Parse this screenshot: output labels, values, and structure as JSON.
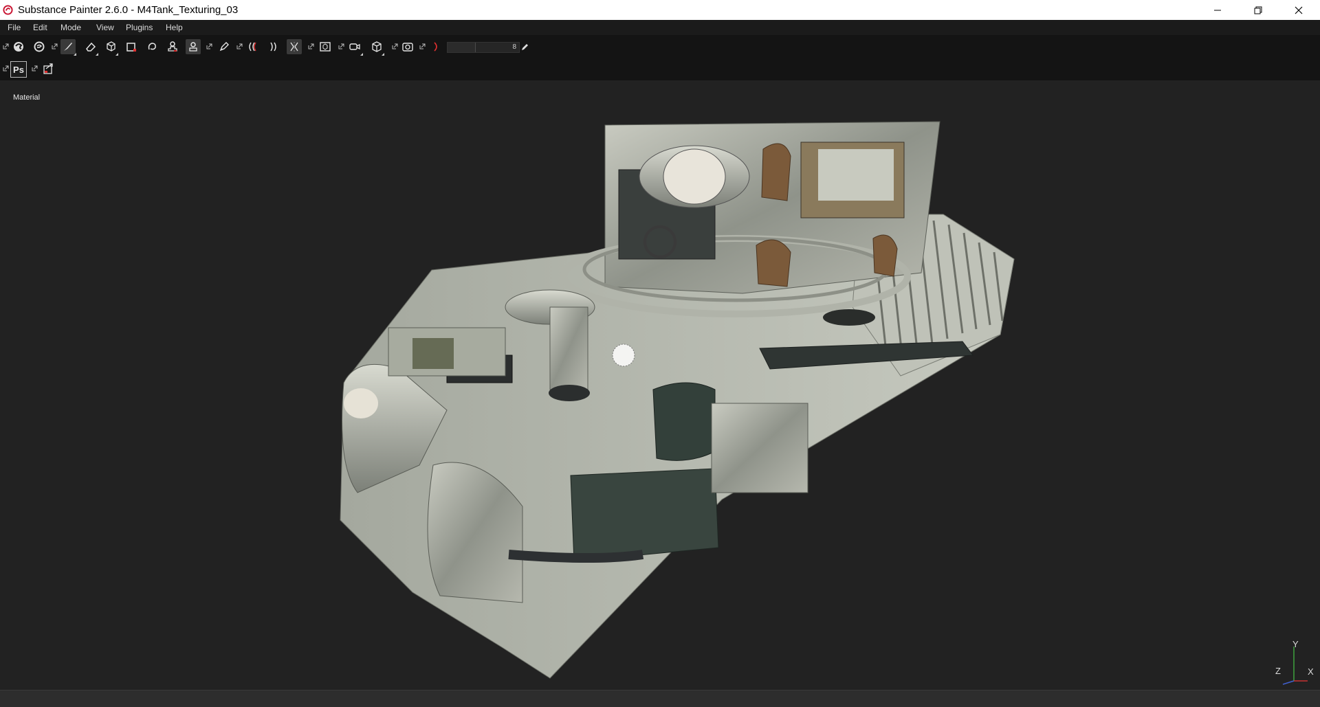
{
  "window": {
    "title": "Substance Painter 2.6.0 - M4Tank_Texturing_03",
    "app_icon": "substance-painter-logo-icon",
    "accent": "#c8102e"
  },
  "menu": [
    "File",
    "Edit",
    "Mode",
    "View",
    "Plugins",
    "Help"
  ],
  "toolbar": {
    "tools": [
      "substance-logo-icon",
      "sync-icon",
      "paint-brush-icon",
      "eraser-icon",
      "projection-cube-icon",
      "polygon-fill-icon",
      "smudge-icon",
      "clone-stamp-icon",
      "material-picker-icon",
      "pen-icon",
      "symmetry-icon",
      "mirror-icon",
      "camera-frame-icon",
      "camera-icon",
      "cube-view-icon",
      "screenshot-icon",
      "lasso-icon"
    ],
    "active_tool": "paint-brush-icon",
    "brush_size_value": "8",
    "row2": [
      "photoshop-export-icon",
      "send-to-icon"
    ],
    "photoshop_label": "Ps"
  },
  "viewport": {
    "mode_label": "Material",
    "axis": {
      "y": "Y",
      "z": "Z",
      "x": "X"
    }
  }
}
